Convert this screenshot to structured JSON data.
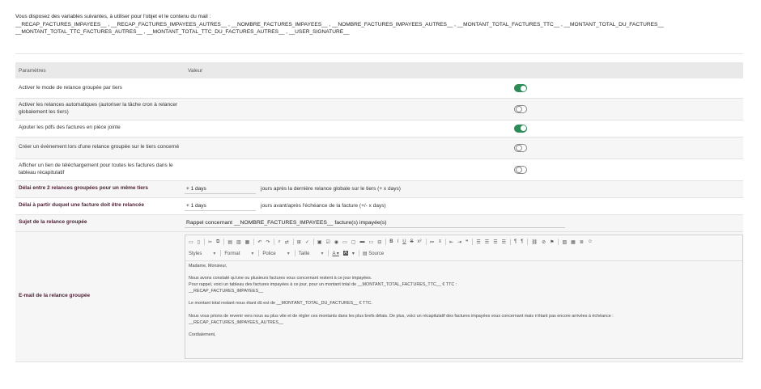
{
  "vars_intro": "Vous disposez des variables suivantes, à utiliser pour l'objet et le contenu du mail :",
  "vars_line1": "__RECAP_FACTURES_IMPAYEES__ , __RECAP_FACTURES_IMPAYEES_AUTRES__ , __NOMBRE_FACTURES_IMPAYEES__ , __NOMBRE_FACTURES_IMPAYEES_AUTRES__ , __MONTANT_TOTAL_FACTURES_TTC__ , __MONTANT_TOTAL_DU_FACTURES__",
  "vars_line2": "__MONTANT_TOTAL_TTC_FACTURES_AUTRES__ , __MONTANT_TOTAL_TTC_DU_FACTURES_AUTRES__ , __USER_SIGNATURE__",
  "table": {
    "col_param": "Paramètres",
    "col_value": "Valeur"
  },
  "rows": [
    {
      "label": "Activer le mode de relance groupée par tiers",
      "toggle": "on"
    },
    {
      "label": "Activer les relances automatiques (autoriser la tâche cron à relancer globalement les tiers)",
      "toggle": "off"
    },
    {
      "label": "Ajouter les pdfs des factures en pièce jointe",
      "toggle": "on"
    },
    {
      "label": "Créer un évènement lors d'une relance groupée sur le tiers concerné",
      "toggle": "off"
    },
    {
      "label": "Afficher un lien de téléchargement pour toutes les factures dans le tableau récapitulatif",
      "toggle": "off"
    }
  ],
  "delay_between": {
    "label": "Délai entre 2 relances groupées pour un même tiers",
    "value": "+ 1 days",
    "suffix": "jours après la dernière relance globale sur le tiers (+ x days)"
  },
  "delay_invoice": {
    "label": "Délai à partir duquel une facture doit être relancée",
    "value": "+ 1 days",
    "suffix": "jours avant/après l'échéance de la facture (+/- x days)"
  },
  "subject": {
    "label": "Sujet de la relance groupée",
    "value": "Rappel concernant __NOMBRE_FACTURES_IMPAYEES__ facture(s) impayée(s)"
  },
  "email": {
    "label": "E-mail de la relance groupée",
    "toolbar": {
      "styles": "Styles",
      "format": "Format",
      "police": "Police",
      "taille": "Taille",
      "source": "Source"
    },
    "body": {
      "l1": "Madame, Monsieur,",
      "l2": "Nous avons constaté qu'une ou plusieurs factures vous concernant restent à ce jour impayées.",
      "l3": "Pour rappel, voici un tableau des factures impayées à ce jour, pour un montant total de __MONTANT_TOTAL_FACTURES_TTC__ € TTC :",
      "l4": "__RECAP_FACTURES_IMPAYEES__",
      "l5": "Le montant total restant nous étant dû est de __MONTANT_TOTAL_DU_FACTURES__ € TTC.",
      "l6": "Nous vous prions de revenir vers nous au plus vite et de régler ces montants dans les plus brefs délais. De plus, voici un récapitulatif des factures impayées vous concernant mais n'étant pas encore arrivées à échéance :",
      "l7": "__RECAP_FACTURES_IMPAYEES_AUTRES__",
      "l8": "Cordialement,"
    }
  },
  "colors": {
    "toggle_on": "#2e8b57",
    "toggle_off": "#8a8a8a",
    "bold_label": "#4a1e33",
    "header_bg": "#e9e9e9"
  }
}
